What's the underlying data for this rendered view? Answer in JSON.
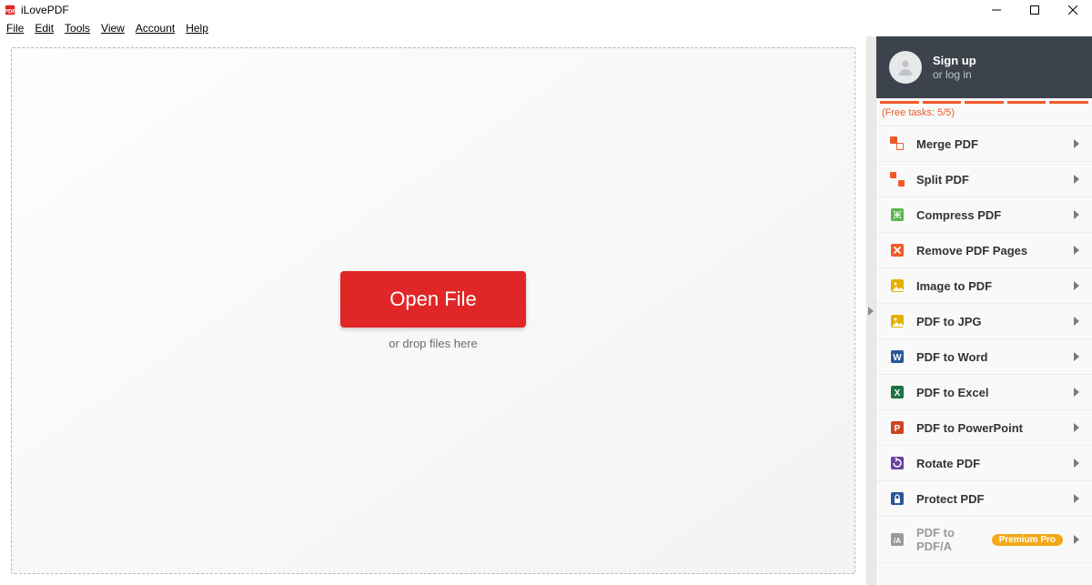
{
  "app": {
    "title": "iLovePDF"
  },
  "menu": {
    "file": "File",
    "edit": "Edit",
    "tools": "Tools",
    "view": "View",
    "account": "Account",
    "help": "Help"
  },
  "main": {
    "open": "Open File",
    "drop": "or drop files here"
  },
  "account": {
    "signup": "Sign up",
    "login": "or log in"
  },
  "quota": {
    "text": "(Free tasks: 5/5)",
    "segments": 5
  },
  "tools": [
    {
      "key": "merge",
      "label": "Merge PDF",
      "icon": "merge",
      "color": "#f05a28"
    },
    {
      "key": "split",
      "label": "Split PDF",
      "icon": "split",
      "color": "#f05a28"
    },
    {
      "key": "compress",
      "label": "Compress PDF",
      "icon": "compress",
      "color": "#5ab552"
    },
    {
      "key": "remove",
      "label": "Remove PDF Pages",
      "icon": "remove",
      "color": "#f05a28"
    },
    {
      "key": "img2pdf",
      "label": "Image to PDF",
      "icon": "img",
      "color": "#e4b100"
    },
    {
      "key": "pdf2jpg",
      "label": "PDF to JPG",
      "icon": "img",
      "color": "#e4b100"
    },
    {
      "key": "pdf2word",
      "label": "PDF to Word",
      "icon": "word",
      "color": "#2a5699"
    },
    {
      "key": "pdf2excel",
      "label": "PDF to Excel",
      "icon": "excel",
      "color": "#1f7244"
    },
    {
      "key": "pdf2ppt",
      "label": "PDF to PowerPoint",
      "icon": "ppt",
      "color": "#d04424"
    },
    {
      "key": "rotate",
      "label": "Rotate PDF",
      "icon": "rotate",
      "color": "#6a3fa0"
    },
    {
      "key": "protect",
      "label": "Protect PDF",
      "icon": "lock",
      "color": "#2a5699"
    },
    {
      "key": "pdfa",
      "label": "PDF to PDF/A",
      "icon": "pdfa",
      "color": "#9a9a9a",
      "disabled": true,
      "badge": "Premium Pro"
    }
  ]
}
